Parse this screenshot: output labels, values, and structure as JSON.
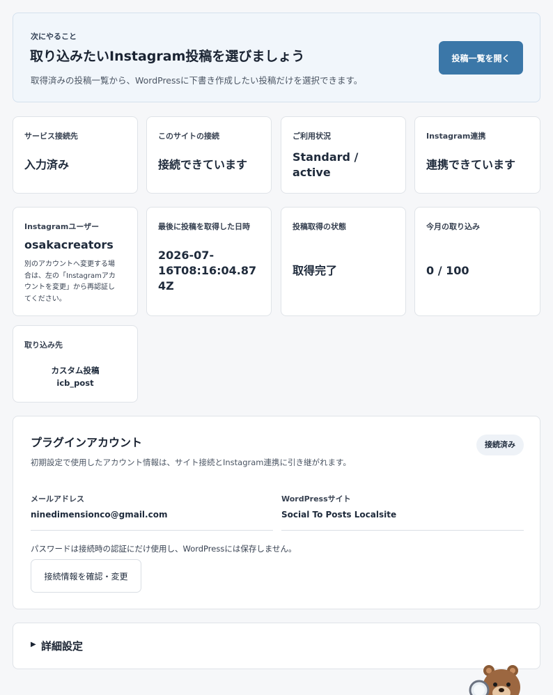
{
  "next_action": {
    "eyebrow": "次にやること",
    "title": "取り込みたいInstagram投稿を選びましょう",
    "description": "取得済みの投稿一覧から、WordPressに下書き作成したい投稿だけを選択できます。",
    "button_label": "投稿一覧を開く"
  },
  "status_cards": [
    {
      "label": "サービス接続先",
      "value": "入力済み"
    },
    {
      "label": "このサイトの接続",
      "value": "接続できています"
    },
    {
      "label": "ご利用状況",
      "value_lines": [
        "Standard /",
        "active"
      ]
    },
    {
      "label": "Instagram連携",
      "value": "連携できています"
    },
    {
      "label": "Instagramユーザー",
      "value": "osakacreators",
      "note_lines": [
        "別のアカウントへ変更する場",
        "合は、左の「Instagramアカ",
        "ウントを変更」から再認証し",
        "てください。"
      ]
    },
    {
      "label": "最後に投稿を取得した日時",
      "value_lines": [
        "2026-07-",
        "16T08:16:04.87",
        "4Z"
      ]
    },
    {
      "label": "投稿取得の状態",
      "value": "取得完了"
    },
    {
      "label": "今月の取り込み",
      "value": "0 / 100",
      "usage": {
        "used": 0,
        "limit": 100
      }
    },
    {
      "label": "取り込み先",
      "value_lines": [
        "カスタム投稿",
        "icb_post"
      ]
    }
  ],
  "plugin_account": {
    "title": "プラグインアカウント",
    "badge": "接続済み",
    "description": "初期設定で使用したアカウント情報は、サイト接続とInstagram連携に引き継がれます。",
    "email_label": "メールアドレス",
    "email_value": "ninedimensionco@gmail.com",
    "site_label": "WordPressサイト",
    "site_value": "Social To Posts Localsite",
    "password_note": "パスワードは接続時の認証にだけ使用し、WordPressには保存しません。",
    "button_label": "接続情報を確認・変更"
  },
  "advanced": {
    "caret": "▶",
    "label": "詳細設定"
  },
  "colors": {
    "primary": "#3b77a8",
    "card_border": "#dfe3e8",
    "highlight_bg": "#f1f6fb",
    "badge_bg": "#eef2f7"
  }
}
